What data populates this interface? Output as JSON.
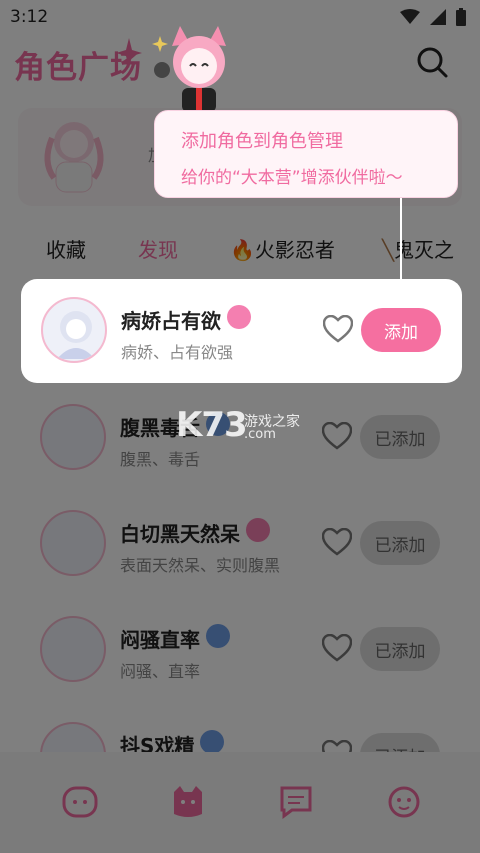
{
  "status": {
    "time": "3:12"
  },
  "header": {
    "title": "角色广场"
  },
  "banner": {
    "text": "加"
  },
  "tabs": [
    {
      "label": "收藏"
    },
    {
      "label": "发现"
    },
    {
      "label": "火影忍者"
    },
    {
      "label": "鬼灭之"
    }
  ],
  "roles": [
    {
      "name": "病娇占有欲",
      "tags": "病娇、占有欲强",
      "gender": "female",
      "action": "添加"
    },
    {
      "name": "腹黑毒舌",
      "tags": "腹黑、毒舌",
      "gender": "male",
      "action": "已添加"
    },
    {
      "name": "白切黑天然呆",
      "tags": "表面天然呆、实则腹黑",
      "gender": "female",
      "action": "已添加"
    },
    {
      "name": "闷骚直率",
      "tags": "闷骚、直率",
      "gender": "male",
      "action": "已添加"
    },
    {
      "name": "抖S戏精",
      "tags": "",
      "gender": "male",
      "action": "已添加"
    }
  ],
  "tooltip": {
    "title": "添加角色到角色管理",
    "subtitle": "给你的“大本营”增添伙伴啦～"
  },
  "watermark": {
    "logo": "K73",
    "site": "游戏之家",
    "domain": ".com"
  },
  "colors": {
    "accent": "#f06ba0",
    "female": "#f47fb0",
    "male": "#6f9ee6"
  },
  "nav": [
    {
      "icon": "face-smile-icon"
    },
    {
      "icon": "cat-face-icon"
    },
    {
      "icon": "chat-bubble-icon"
    },
    {
      "icon": "happy-face-icon"
    }
  ]
}
